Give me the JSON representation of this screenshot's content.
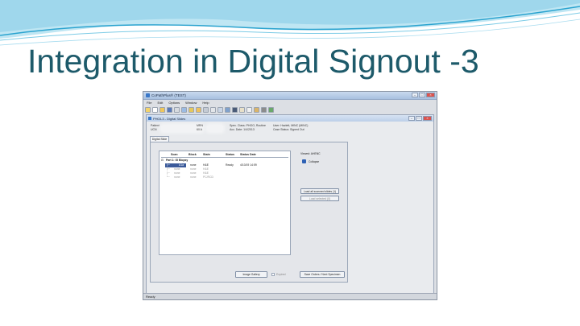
{
  "slide": {
    "title": "Integration in Digital Signout -3"
  },
  "app": {
    "window_title": "CoPathPlus® (TEST)",
    "menu": [
      "File",
      "Edit",
      "Options",
      "Window",
      "Help"
    ],
    "child_title": "PH03-3 - Digital Slides",
    "info": {
      "patient_label": "Patient",
      "mrn_label": "MRN",
      "col1_extra_label": "UCN",
      "sex_age_label": "60 A",
      "spec_class_label": "Spec. Class:",
      "spec_class_value": "PHOO, Routine",
      "acc_date_label": "Acc. Date:",
      "acc_date_value": "1/4/2013",
      "user_label": "User:",
      "user_value": "Hazlett, MINC (MINC)",
      "case_status_label": "Case Status:",
      "case_status_value": "Signed Out"
    },
    "tab_label": "Digital Slide",
    "table": {
      "headers": [
        "Scan",
        "Block",
        "Stain",
        "Status",
        "Status Date"
      ],
      "group_label": "Part 1: GI Biopsy",
      "rows": [
        {
          "scan": "",
          "block": "A1a",
          "stain": "none",
          "stainv": "H&E",
          "status": "Ready",
          "date": "4/10/19 14:59"
        },
        {
          "scan": "",
          "block": "none",
          "stain": "none",
          "stainv": "H&E",
          "status": "",
          "date": ""
        },
        {
          "scan": "",
          "block": "none",
          "stain": "none",
          "stainv": "H&E",
          "status": "",
          "date": ""
        },
        {
          "scan": "",
          "block": "none",
          "stain": "none",
          "stainv": "PC/RCD",
          "status": "",
          "date": ""
        }
      ]
    },
    "viewer_label": "Viewed: AHENC",
    "collapse_label": "Collapse",
    "load_all_button": "Load all scanned slides (1)",
    "load_selected_button": "Load selected (0)",
    "image_gallery_button": "Image Gallery",
    "expired_label": "Expired",
    "save_orders_button": "Save Orders / Next Specimen",
    "status_text": "Ready"
  },
  "colors": {
    "title": "#1d5a6a",
    "wave_light": "#bfe6f3",
    "wave_dark": "#2aa3cf"
  }
}
